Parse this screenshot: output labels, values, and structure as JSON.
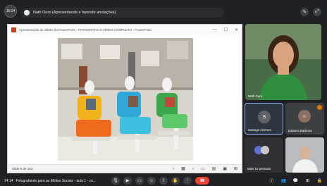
{
  "topbar": {
    "cam_badge": "16:14",
    "presenter_text": "Nath Ouro (Apresentando e fazendo anotações)"
  },
  "ppt": {
    "window_title": "Apresentação de Slides do PowerPoint - FOTOGRAFIA E VÍDEO COMPLETO - PowerPoint",
    "slide_counter": "Slide 6 de 153"
  },
  "participants": {
    "main": "Nath Ouro",
    "s_initial": "S",
    "s_name": "Solange Hermes",
    "d_name": "Daisons Barbosa",
    "more_label": "Mais 18 pessoas"
  },
  "bottombar": {
    "time": "14:14",
    "meeting": "Fotografando para as Mídias Sociais - aula 1 - co..."
  },
  "colors": {
    "end_call": "#ea4335",
    "accent": "#8ab4f8"
  }
}
